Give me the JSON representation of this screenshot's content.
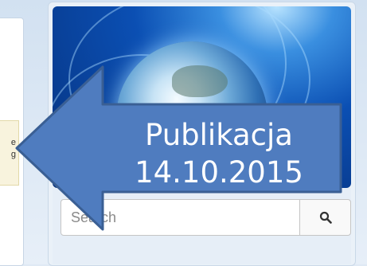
{
  "notice": {
    "line1": "e",
    "line2": "g"
  },
  "search": {
    "placeholder": "Search",
    "button_icon": "search-icon"
  },
  "callout": {
    "title": "Publikacja",
    "date": "14.10.2015",
    "fill_color": "#4f7cbf",
    "border_color": "#3a5f94"
  },
  "banner": {
    "image": "globe-image"
  }
}
